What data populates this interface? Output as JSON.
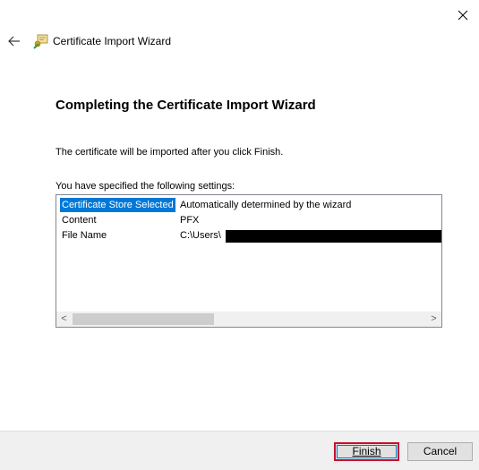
{
  "window": {
    "title": "Certificate Import Wizard"
  },
  "page": {
    "heading": "Completing the Certificate Import Wizard",
    "intro": "The certificate will be imported after you click Finish.",
    "settings_label": "You have specified the following settings:"
  },
  "settings": [
    {
      "key": "Certificate Store Selected",
      "value": "Automatically determined by the wizard",
      "selected": true
    },
    {
      "key": "Content",
      "value": "PFX",
      "selected": false
    },
    {
      "key": "File Name",
      "value": "C:\\Users\\",
      "selected": false,
      "redacted": true
    }
  ],
  "scrollbar": {
    "left_arrow": "<",
    "right_arrow": ">"
  },
  "buttons": {
    "finish": "Finish",
    "cancel": "Cancel"
  },
  "colors": {
    "selection": "#0078d7",
    "focus_highlight": "#c8102e",
    "footer": "#f0f0f0"
  }
}
